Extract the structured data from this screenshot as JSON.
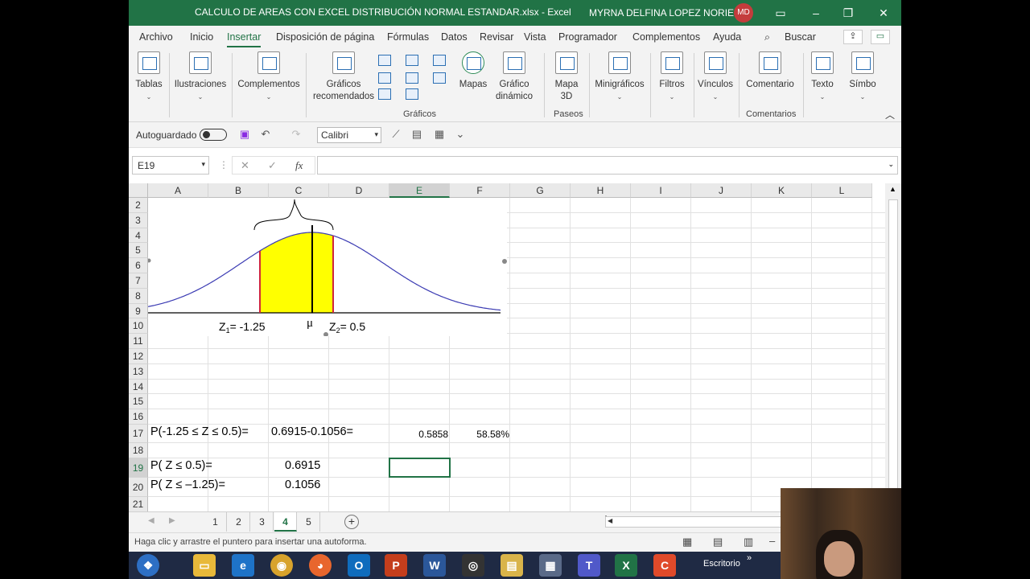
{
  "window": {
    "title": "CALCULO DE AREAS CON EXCEL DISTRIBUCIÓN NORMAL ESTANDAR.xlsx  -  Excel",
    "user_name": "MYRNA DELFINA LOPEZ NORIEGA",
    "user_initials": "MD"
  },
  "menu": {
    "tabs": [
      "Archivo",
      "Inicio",
      "Insertar",
      "Disposición de página",
      "Fórmulas",
      "Datos",
      "Revisar",
      "Vista",
      "Programador",
      "Complementos",
      "Ayuda"
    ],
    "active_tab": "Insertar",
    "search_label": "Buscar"
  },
  "ribbon": {
    "tables": "Tablas",
    "illustrations": "Ilustraciones",
    "addins": "Complementos",
    "recommended_charts_1": "Gráficos",
    "recommended_charts_2": "recomendados",
    "maps": "Mapas",
    "pivot_chart_1": "Gráfico",
    "pivot_chart_2": "dinámico",
    "map3d_1": "Mapa",
    "map3d_2": "3D",
    "sparklines": "Minigráficos",
    "filters": "Filtros",
    "links": "Vínculos",
    "comment": "Comentario",
    "text": "Texto",
    "symbols": "Símbo",
    "group_charts": "Gráficos",
    "group_tours": "Paseos",
    "group_comments": "Comentarios"
  },
  "quick_access": {
    "autosave_label": "Autoguardado",
    "font_name": "Calibri"
  },
  "formula_bar": {
    "name_box": "E19",
    "fx": "fx",
    "formula": ""
  },
  "grid": {
    "columns": [
      "A",
      "B",
      "C",
      "D",
      "E",
      "F",
      "G",
      "H",
      "I",
      "J",
      "K",
      "L"
    ],
    "selected_column": "E",
    "rows": [
      "2",
      "3",
      "4",
      "5",
      "6",
      "7",
      "8",
      "9",
      "10",
      "11",
      "12",
      "13",
      "14",
      "15",
      "16",
      "17",
      "18",
      "19",
      "20",
      "21"
    ],
    "selected_row": "19",
    "cells": {
      "A17": "P(-1.25 ≤ Z ≤ 0.5)=",
      "C17": "0.6915-0.1056=",
      "E17": "0.5858",
      "F17": "58.58%",
      "A19": "P( Z ≤ 0.5)=",
      "C19": "0.6915",
      "A20": "P( Z ≤ –1.25)=",
      "C20": "0.1056"
    }
  },
  "figure": {
    "z1_label": "Z",
    "z1_sub": "1",
    "z1_value": "= -1.25",
    "mu_label": "μ",
    "z2_label": "Z",
    "z2_sub": "2",
    "z2_value": "= 0.5",
    "shade_color": "#ffff00",
    "curve_color": "#3b3bb3",
    "bound_color": "#d0263b"
  },
  "sheets": {
    "tabs": [
      "1",
      "2",
      "3",
      "4",
      "5"
    ],
    "active": "4"
  },
  "status": {
    "message": "Haga clic y arrastre el puntero para insertar una autoforma."
  },
  "taskbar": {
    "desktop_label": "Escritorio"
  }
}
